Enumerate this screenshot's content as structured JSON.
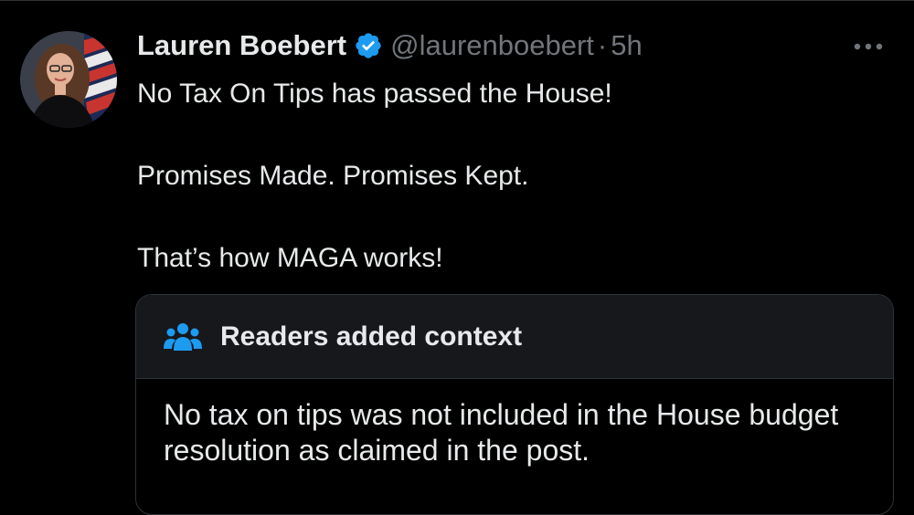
{
  "post": {
    "display_name": "Lauren Boebert",
    "handle": "@laurenboebert",
    "separator": "·",
    "time": "5h",
    "verified_icon": "verified-badge-icon",
    "more_icon": "more-options-icon",
    "text_lines": [
      "No Tax On Tips has passed the House!",
      "Promises Made. Promises Kept.",
      "That’s how MAGA works!"
    ]
  },
  "community_note": {
    "icon": "people-icon",
    "title": "Readers added context",
    "body": "No tax on tips was not included in the House budget resolution as claimed in the post."
  },
  "colors": {
    "background": "#000000",
    "text_primary": "#e7e9ea",
    "text_secondary": "#71767b",
    "accent_blue": "#1d9bf0",
    "border": "#2f3336",
    "note_header_bg": "#16181c"
  }
}
